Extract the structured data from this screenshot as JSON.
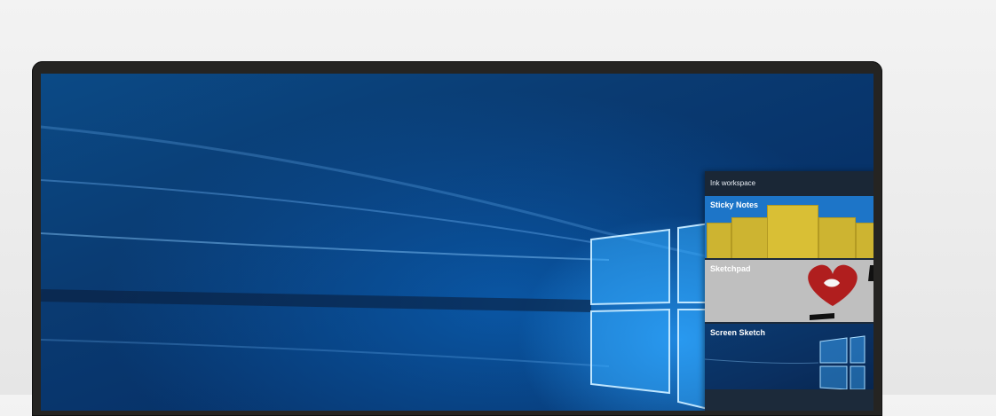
{
  "ink_workspace": {
    "title": "Ink workspace",
    "tiles": [
      {
        "label": "Sticky Notes"
      },
      {
        "label": "Sketchpad"
      },
      {
        "label": "Screen Sketch"
      }
    ]
  },
  "colors": {
    "desktop_blue": "#0a3b72",
    "window_glow": "#3fb0ff",
    "sticky_yellow": "#cdb431",
    "tile_blue": "#1d75c8",
    "heart_red": "#b01e1e"
  }
}
